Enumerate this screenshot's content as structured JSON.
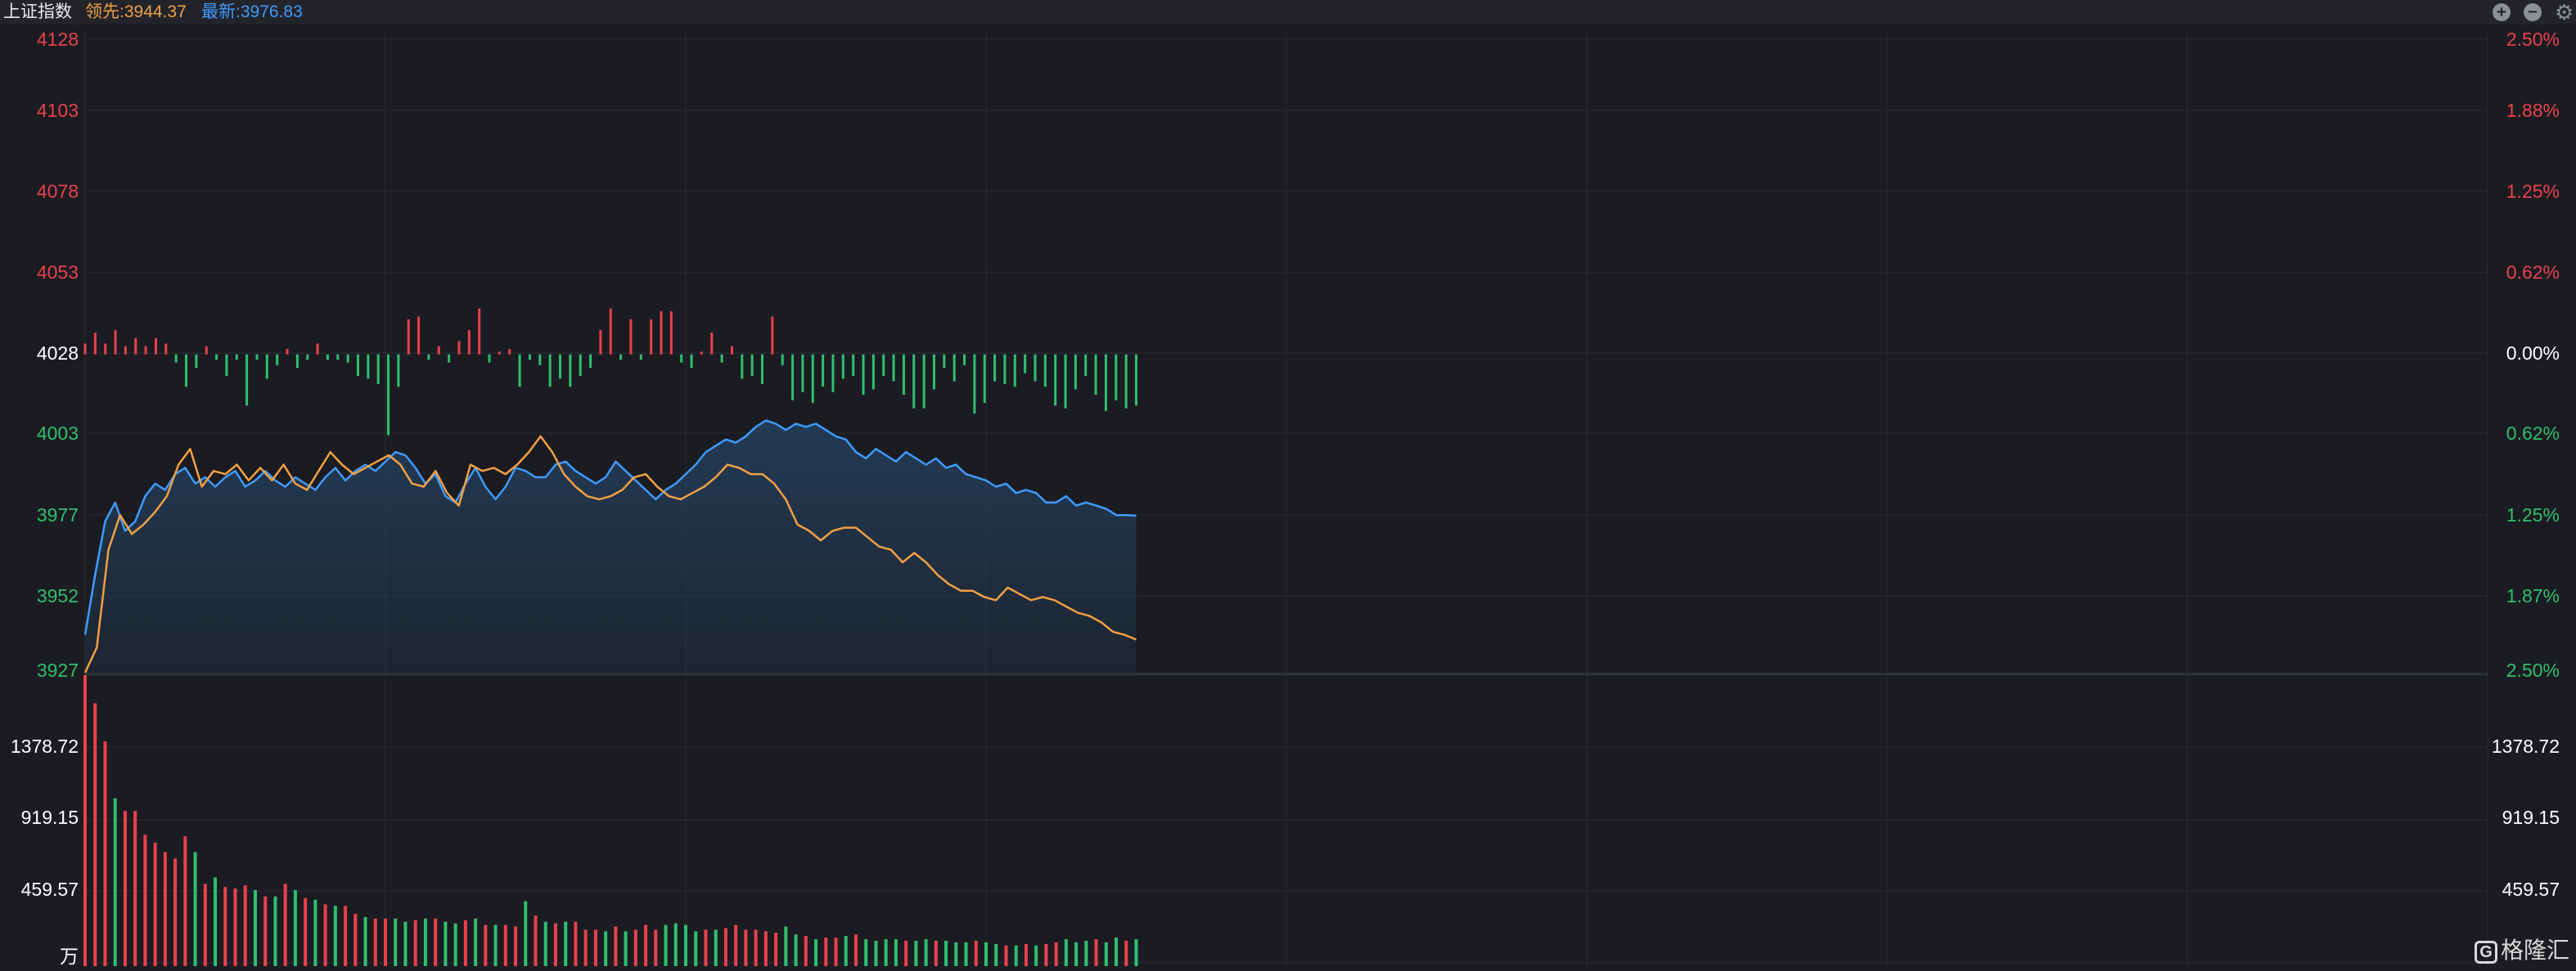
{
  "header": {
    "index_name": "上证指数",
    "lead": "领先:3944.37",
    "latest": "最新:3976.83"
  },
  "toolbar": {
    "zoom_in_icon": "plus-circle-icon",
    "zoom_out_icon": "minus-circle-icon",
    "settings_icon": "gear-icon"
  },
  "watermark": {
    "text": "格隆汇",
    "icon": "gelonghui-logo-icon"
  },
  "colors": {
    "background": "#1b1c21",
    "grid": "#2a2c33",
    "up": "#e8414e",
    "down": "#2fbf71",
    "neutral": "#ffffff",
    "latest_line": "#3f9bff",
    "lead_line": "#f0a043",
    "area_fill": "#24405f"
  },
  "chart_data": [
    {
      "type": "line",
      "title": "上证指数",
      "prev_close": 4028,
      "ylim": [
        3927,
        4128
      ],
      "y_ticks_left": [
        "4128",
        "4103",
        "4078",
        "4053",
        "4028",
        "4003",
        "3977",
        "3952",
        "3927"
      ],
      "y_ticks_right": [
        "2.50%",
        "1.88%",
        "1.25%",
        "0.62%",
        "0.00%",
        "0.62%",
        "1.25%",
        "1.87%",
        "2.50%"
      ],
      "x_total_points": 240,
      "series": [
        {
          "name": "最新",
          "color": "#3f9bff",
          "fill": true,
          "values": [
            3939,
            3958,
            3975,
            3981,
            3972,
            3975,
            3983,
            3987,
            3985,
            3990,
            3992,
            3987,
            3989,
            3986,
            3989,
            3991,
            3986,
            3988,
            3991,
            3988,
            3986,
            3989,
            3987,
            3985,
            3989,
            3992,
            3988,
            3991,
            3993,
            3991,
            3994,
            3997,
            3996,
            3992,
            3987,
            3990,
            3983,
            3981,
            3987,
            3992,
            3986,
            3982,
            3986,
            3992,
            3991,
            3989,
            3989,
            3993,
            3994,
            3991,
            3989,
            3987,
            3989,
            3994,
            3991,
            3988,
            3985,
            3982,
            3985,
            3987,
            3990,
            3993,
            3997,
            3999,
            4001,
            4000,
            4002,
            4005,
            4007,
            4006,
            4004,
            4006,
            4005,
            4006,
            4004,
            4002,
            4001,
            3997,
            3995,
            3998,
            3996,
            3994,
            3997,
            3995,
            3993,
            3995,
            3992,
            3993,
            3990,
            3989,
            3988,
            3986,
            3987,
            3984,
            3985,
            3984,
            3981,
            3981,
            3983,
            3980,
            3981,
            3980,
            3979,
            3977,
            3977,
            3976.83
          ]
        },
        {
          "name": "领先",
          "color": "#f0a043",
          "fill": false,
          "values": [
            3927,
            3935,
            3966,
            3977,
            3971,
            3974,
            3978,
            3983,
            3993,
            3998,
            3986,
            3991,
            3990,
            3993,
            3988,
            3992,
            3988,
            3993,
            3987,
            3985,
            3991,
            3997,
            3993,
            3990,
            3992,
            3994,
            3996,
            3993,
            3987,
            3986,
            3991,
            3984,
            3980,
            3993,
            3991,
            3992,
            3990,
            3993,
            3997,
            4002,
            3997,
            3990,
            3986,
            3983,
            3982,
            3983,
            3985,
            3989,
            3990,
            3986,
            3983,
            3982,
            3984,
            3986,
            3989,
            3993,
            3992,
            3990,
            3990,
            3987,
            3982,
            3974,
            3972,
            3969,
            3972,
            3973,
            3973,
            3970,
            3967,
            3966,
            3962,
            3965,
            3962,
            3958,
            3955,
            3953,
            3953,
            3951,
            3950,
            3954,
            3952,
            3950,
            3951,
            3950,
            3948,
            3946,
            3945,
            3943,
            3940,
            3939,
            3937.5
          ]
        }
      ],
      "diff_bars": [
        4,
        8,
        4,
        9,
        3,
        6,
        3,
        6,
        4,
        -3,
        -12,
        -5,
        3,
        -2,
        -8,
        -2,
        -19,
        -2,
        -9,
        -4,
        2,
        -5,
        -2,
        4,
        -2,
        -2,
        -3,
        -8,
        -9,
        -11,
        -30,
        -12,
        13,
        14,
        -2,
        3,
        -3,
        5,
        9,
        17,
        -3,
        1,
        2,
        -12,
        -2,
        -4,
        -12,
        -9,
        -12,
        -8,
        -5,
        9,
        17,
        -2,
        13,
        -2,
        13,
        16,
        16,
        -3,
        -5,
        1,
        8,
        -3,
        3,
        -9,
        -8,
        -11,
        14,
        -4,
        -17,
        -14,
        -18,
        -12,
        -14,
        -9,
        -8,
        -15,
        -13,
        -8,
        -10,
        -15,
        -20,
        -20,
        -13,
        -5,
        -10,
        -4,
        -22,
        -18,
        -10,
        -11,
        -12,
        -7,
        -10,
        -12,
        -19,
        -20,
        -13,
        -8,
        -15,
        -21,
        -17,
        -20,
        -19
      ],
      "diff_colors_note": "positive bars red above the 4028 baseline, negative bars green below"
    },
    {
      "type": "bar",
      "title": "成交量",
      "unit": "万",
      "ylim": [
        0,
        1838.29
      ],
      "y_ticks": [
        "1378.72",
        "919.15",
        "459.57"
      ],
      "values": [
        1840,
        1660,
        1420,
        1060,
        980,
        980,
        830,
        780,
        720,
        680,
        820,
        720,
        520,
        560,
        500,
        490,
        510,
        480,
        440,
        440,
        520,
        480,
        430,
        420,
        390,
        380,
        380,
        330,
        310,
        300,
        300,
        300,
        280,
        290,
        300,
        300,
        280,
        270,
        290,
        300,
        260,
        260,
        260,
        250,
        410,
        320,
        280,
        270,
        280,
        280,
        230,
        230,
        220,
        250,
        220,
        230,
        260,
        230,
        260,
        270,
        260,
        220,
        230,
        230,
        240,
        260,
        230,
        230,
        220,
        210,
        250,
        200,
        190,
        170,
        180,
        180,
        190,
        200,
        170,
        160,
        170,
        170,
        160,
        160,
        170,
        160,
        160,
        150,
        150,
        160,
        150,
        140,
        130,
        130,
        140,
        130,
        140,
        150,
        170,
        150,
        160,
        170,
        150,
        180,
        160,
        170
      ],
      "colors": [
        "up",
        "up",
        "up",
        "down",
        "up",
        "up",
        "up",
        "up",
        "up",
        "up",
        "up",
        "down",
        "up",
        "down",
        "up",
        "up",
        "up",
        "down",
        "up",
        "down",
        "up",
        "down",
        "up",
        "down",
        "up",
        "down",
        "up",
        "up",
        "down",
        "up",
        "up",
        "down",
        "down",
        "up",
        "down",
        "up",
        "down",
        "down",
        "up",
        "down",
        "up",
        "down",
        "up",
        "up",
        "down",
        "up",
        "down",
        "up",
        "down",
        "up",
        "up",
        "up",
        "down",
        "up",
        "down",
        "up",
        "up",
        "up",
        "down",
        "down",
        "down",
        "down",
        "up",
        "down",
        "up",
        "up",
        "up",
        "up",
        "up",
        "up",
        "down",
        "down",
        "up",
        "down",
        "up",
        "up",
        "down",
        "up",
        "down",
        "down",
        "down",
        "down",
        "up",
        "down",
        "down",
        "up",
        "down",
        "down",
        "down",
        "up",
        "down",
        "down",
        "up",
        "down",
        "up",
        "down",
        "up",
        "up",
        "down",
        "down",
        "down",
        "up",
        "down",
        "down",
        "up",
        "down"
      ]
    }
  ]
}
